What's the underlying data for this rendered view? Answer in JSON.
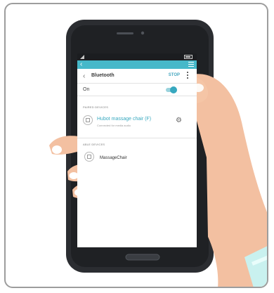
{
  "screen": {
    "toolbar": {
      "title": "Bluetooth",
      "stop_label": "STOP"
    },
    "on_row": {
      "label": "On"
    },
    "paired": {
      "header": "PAIRED DEVICES",
      "device_name": "Hubot massage chair (F)",
      "device_status": "Connected for media audio"
    },
    "available": {
      "header": "ABLE DEVICES",
      "device_name": "MassageChair"
    }
  },
  "colors": {
    "accent": "#46b8c9",
    "device_name_active": "#37a8bf"
  },
  "icons": {
    "back": "back-icon",
    "menu": "menu-icon",
    "overflow": "overflow-icon",
    "device": "device-icon",
    "settings": "gear-icon"
  }
}
